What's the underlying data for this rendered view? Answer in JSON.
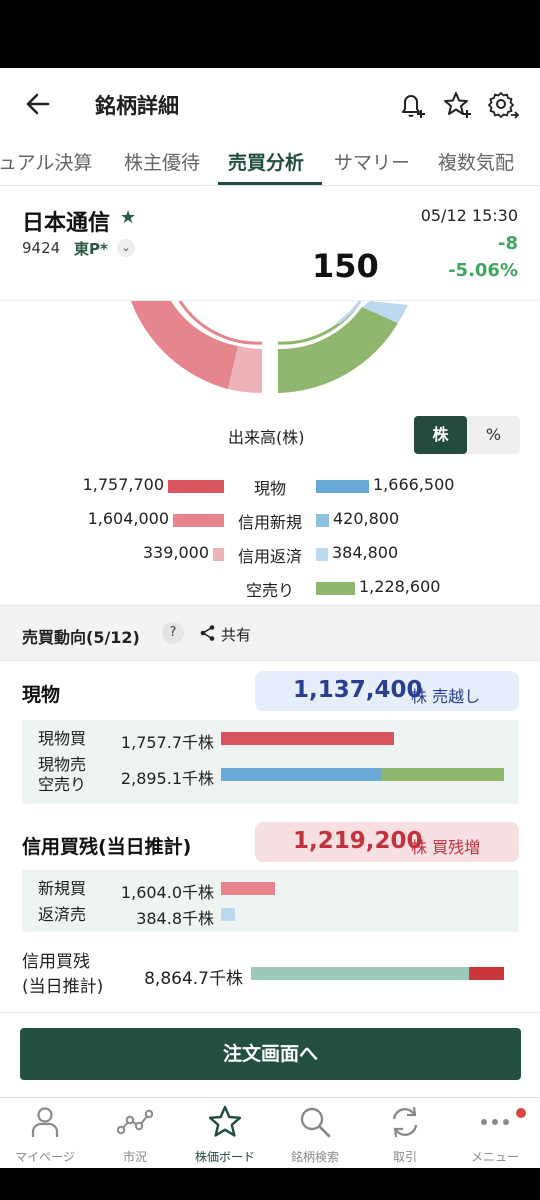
{
  "header": {
    "title": "銘柄詳細"
  },
  "tabs": [
    {
      "label": "ュアル決算"
    },
    {
      "label": "株主優待"
    },
    {
      "label": "売買分析"
    },
    {
      "label": "サマリー"
    },
    {
      "label": "複数気配"
    }
  ],
  "stock": {
    "name": "日本通信",
    "code": "9424",
    "market": "東P*",
    "price": "150",
    "datetime": "05/12 15:30",
    "change": "-8",
    "change_pct": "-5.06%"
  },
  "volume": {
    "title": "出来高(株)",
    "unit_options": [
      "株",
      "%"
    ],
    "unit_selected": "株",
    "rows": [
      {
        "left_value": "1,757,700",
        "left_fraction": 1.0,
        "left_color": "#d9545f",
        "category": "現物",
        "right_value": "1,666,500",
        "right_fraction": 1.0,
        "right_color": "#6aa9d6"
      },
      {
        "left_value": "1,604,000",
        "left_fraction": 0.91,
        "left_color": "#e6858e",
        "category": "信用新規",
        "right_value": "420,800",
        "right_fraction": 0.25,
        "right_color": "#8fc0e0"
      },
      {
        "left_value": "339,000",
        "left_fraction": 0.19,
        "left_color": "#edb3b8",
        "category": "信用返済",
        "right_value": "384,800",
        "right_fraction": 0.23,
        "right_color": "#bcd9ee"
      },
      {
        "left_value": "",
        "left_fraction": 0,
        "left_color": "#ffffff",
        "category": "空売り",
        "right_value": "1,228,600",
        "right_fraction": 0.74,
        "right_color": "#8fb86e"
      }
    ]
  },
  "trend": {
    "title": "売買動向(5/12)",
    "help": "?",
    "share_label": "共有",
    "spot": {
      "title": "現物",
      "badge_value": "1,137,400",
      "badge_suffix": "株 売越し",
      "badge_text_color": "#2a3e8f",
      "badge_bg": "#e6eefb",
      "rows": [
        {
          "label": "現物買",
          "value": "1,757.7千株",
          "segments": [
            {
              "fraction": 0.61,
              "color": "#d9545f"
            }
          ]
        },
        {
          "label": "現物売\n空売り",
          "value": "2,895.1千株",
          "segments": [
            {
              "fraction": 0.57,
              "color": "#6aa9d6"
            },
            {
              "fraction": 0.43,
              "color": "#8fb86e"
            }
          ]
        }
      ]
    },
    "margin": {
      "title": "信用買残(当日推計)",
      "badge_value": "1,219,200",
      "badge_suffix": "株 買残増",
      "badge_text_color": "#c0333f",
      "badge_bg": "#f8dfe1",
      "rows": [
        {
          "label": "新規買",
          "value": "1,604.0千株",
          "segments": [
            {
              "fraction": 0.19,
              "color": "#e6858e"
            }
          ]
        },
        {
          "label": "返済売",
          "value": "384.8千株",
          "segments": [
            {
              "fraction": 0.05,
              "color": "#bcd9ee"
            }
          ]
        }
      ],
      "balance": {
        "label": "信用買残\n(当日推計)",
        "value": "8,864.7千株",
        "segments": [
          {
            "fraction": 0.86,
            "color": "#9cc9bb"
          },
          {
            "fraction": 0.14,
            "color": "#c9373d"
          }
        ]
      }
    }
  },
  "order_button": "注文画面へ",
  "nav": [
    {
      "label": "マイページ",
      "icon": "person-icon"
    },
    {
      "label": "市況",
      "icon": "market-chart-icon"
    },
    {
      "label": "株価ボード",
      "icon": "star-icon",
      "active": true
    },
    {
      "label": "銘柄検索",
      "icon": "search-icon"
    },
    {
      "label": "取引",
      "icon": "refresh-icon"
    },
    {
      "label": "メニュー",
      "icon": "more-icon"
    }
  ],
  "colors": {
    "brand": "#23503f",
    "up_green": "#3fa660"
  }
}
